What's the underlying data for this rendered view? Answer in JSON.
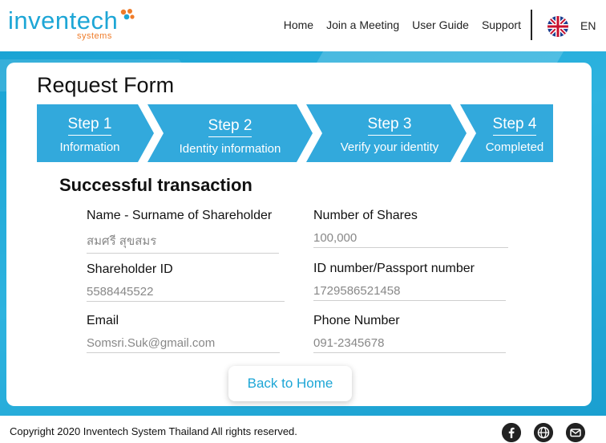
{
  "header": {
    "logo_text_a": "inven",
    "logo_text_b": "tech",
    "logo_sub": "systems",
    "nav": [
      "Home",
      "Join a Meeting",
      "User Guide",
      "Support"
    ],
    "language": "EN",
    "flag_icon": "uk-flag-icon"
  },
  "card": {
    "title": "Request Form",
    "steps": [
      {
        "num": "Step 1",
        "desc": "Information",
        "color": "#32a9dc"
      },
      {
        "num": "Step 2",
        "desc": "Identity information",
        "color": "#32a9dc"
      },
      {
        "num": "Step 3",
        "desc": "Verify your identity",
        "color": "#32a9dc"
      },
      {
        "num": "Step 4",
        "desc": "Completed",
        "color": "#32a9dc"
      }
    ],
    "success_heading": "Successful transaction",
    "fields": {
      "name_label": "Name - Surname of Shareholder",
      "name_value": "สมศรี สุขสมร",
      "shares_label": "Number of Shares",
      "shares_value": "100,000",
      "shareholder_id_label": "Shareholder ID",
      "shareholder_id_value": "5588445522",
      "id_number_label": "ID number/Passport number",
      "id_number_value": "1729586521458",
      "email_label": "Email",
      "email_value": "Somsri.Suk@gmail.com",
      "phone_label": "Phone Number",
      "phone_value": "091-2345678"
    },
    "back_button": "Back to Home"
  },
  "footer": {
    "copyright": "Copyright  2020 Inventech System Thailand All rights reserved.",
    "icons": [
      "facebook-icon",
      "globe-icon",
      "mail-icon"
    ]
  },
  "colors": {
    "brand_blue": "#1da6d6",
    "brand_orange": "#ef7c2a",
    "step_blue": "#32a9dc"
  }
}
